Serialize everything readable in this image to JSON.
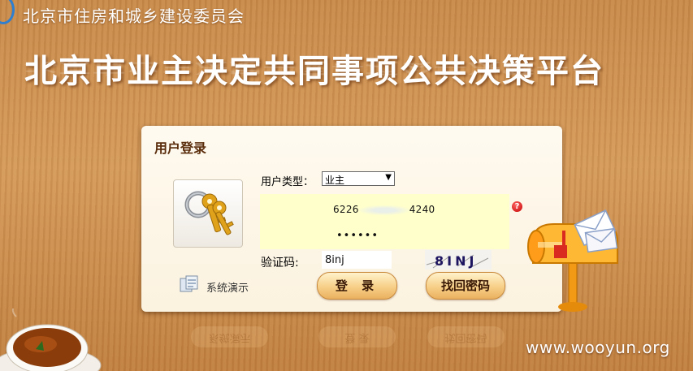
{
  "header": {
    "org_name": "北京市住房和城乡建设委员会",
    "platform_title": "北京市业主决定共同事项公共决策平台"
  },
  "login_panel": {
    "title": "用户登录",
    "user_type_label": "用户类型：",
    "user_type_selected": "业主",
    "account_prefix": "6226",
    "account_suffix": "4240",
    "password_mask": "••••••",
    "captcha_label": "验证码:",
    "captcha_value": "8inj",
    "captcha_image_text": "8INJ",
    "help_glyph": "?",
    "login_button": "登 录",
    "recover_button": "找回密码",
    "demo_label": "系统演示"
  },
  "footer": {
    "watermark": "www.wooyun.org"
  },
  "icons": [
    "keys-icon",
    "help-icon",
    "demo-icon",
    "mailbox-icon",
    "tea-cup-icon"
  ],
  "colors": {
    "wood": "#c88a4a",
    "panel": "#fffaf0",
    "input_highlight": "#ffffcc",
    "title_text": "#5a2d0c"
  }
}
